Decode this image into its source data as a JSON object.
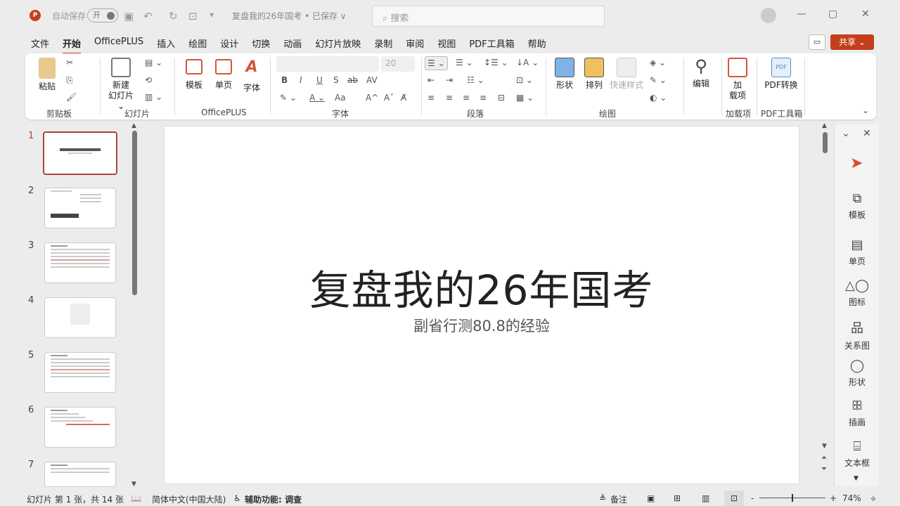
{
  "titlebar": {
    "app_logo": "P",
    "autosave_label": "自动保存",
    "autosave_state": "开",
    "doc_title": "复盘我的26年国考 • 已保存 ∨",
    "search_placeholder": "搜索"
  },
  "menu": [
    "文件",
    "开始",
    "OfficePLUS",
    "插入",
    "绘图",
    "设计",
    "切换",
    "动画",
    "幻灯片放映",
    "录制",
    "审阅",
    "视图",
    "PDF工具箱",
    "帮助"
  ],
  "share_label": "共享 ⌄",
  "ribbon": {
    "clipboard": {
      "paste": "粘贴",
      "label": "剪贴板"
    },
    "slides": {
      "new_slide_1": "新建",
      "new_slide_2": "幻灯片 ⌄",
      "label": "幻灯片"
    },
    "officeplus": {
      "template": "模板",
      "single": "单页",
      "font": "字体",
      "label": "OfficePLUS"
    },
    "font": {
      "size": "20",
      "bold": "B",
      "italic": "I",
      "underline": "U",
      "shadow": "S",
      "strike": "ab",
      "spacing": "AV",
      "case": "Aa",
      "grow": "A^",
      "shrink": "Aˇ",
      "label": "字体"
    },
    "paragraph": {
      "label": "段落"
    },
    "drawing": {
      "shapes": "形状",
      "arrange": "排列",
      "quick_styles": "快速样式",
      "label": "绘图"
    },
    "editing": {
      "edit": "编辑"
    },
    "addins": {
      "addin_1": "加",
      "addin_2": "载项",
      "label": "加载项"
    },
    "pdf": {
      "convert": "PDF转换",
      "label": "PDF工具箱"
    }
  },
  "slides_panel": [
    {
      "n": "1"
    },
    {
      "n": "2"
    },
    {
      "n": "3"
    },
    {
      "n": "4"
    },
    {
      "n": "5"
    },
    {
      "n": "6"
    },
    {
      "n": "7"
    }
  ],
  "slide": {
    "title": "复盘我的26年国考",
    "subtitle": "副省行测80.8的经验"
  },
  "right_pane": [
    "模板",
    "单页",
    "图标",
    "关系图",
    "形状",
    "插画",
    "文本框"
  ],
  "status": {
    "slide_info": "幻灯片 第 1 张，共 14 张",
    "language": "简体中文(中国大陆)",
    "accessibility": "辅助功能: 调查",
    "notes": "备注",
    "zoom": "74%"
  },
  "colors": {
    "accent": "#c43e1c"
  }
}
